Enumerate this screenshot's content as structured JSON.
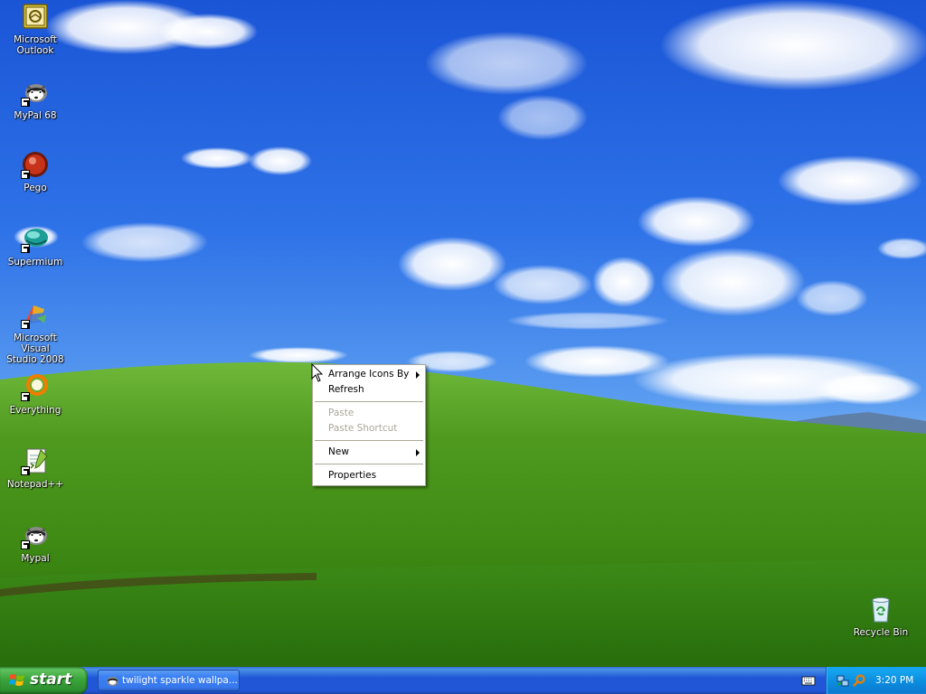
{
  "desktop": {
    "icons": [
      {
        "label_line1": "Microsoft",
        "label_line2": "Outlook",
        "icon": "outlook-icon"
      },
      {
        "label_line1": "MyPal 68",
        "label_line2": "",
        "icon": "mypal-icon"
      },
      {
        "label_line1": "Pego",
        "label_line2": "",
        "icon": "pego-icon"
      },
      {
        "label_line1": "Supermium",
        "label_line2": "",
        "icon": "supermium-icon"
      },
      {
        "label_line1": "Microsoft Visual",
        "label_line2": "Studio 2008",
        "icon": "visual-studio-icon"
      },
      {
        "label_line1": "Everything",
        "label_line2": "",
        "icon": "everything-icon"
      },
      {
        "label_line1": "Notepad++",
        "label_line2": "",
        "icon": "notepad-plus-plus-icon"
      },
      {
        "label_line1": "Mypal",
        "label_line2": "",
        "icon": "mypal-icon"
      },
      {
        "label_line1": "Recycle Bin",
        "label_line2": "",
        "icon": "recycle-bin-icon"
      }
    ]
  },
  "context_menu": {
    "items": [
      {
        "label": "Arrange Icons By",
        "has_submenu": true,
        "enabled": true
      },
      {
        "label": "Refresh",
        "has_submenu": false,
        "enabled": true
      },
      {
        "label": "Paste",
        "has_submenu": false,
        "enabled": false
      },
      {
        "label": "Paste Shortcut",
        "has_submenu": false,
        "enabled": false
      },
      {
        "label": "New",
        "has_submenu": true,
        "enabled": true
      },
      {
        "label": "Properties",
        "has_submenu": false,
        "enabled": true
      }
    ]
  },
  "taskbar": {
    "start_label": "start",
    "task_button_label": "twilight sparkle wallpa...",
    "clock": "3:20 PM"
  },
  "colors": {
    "taskbar_blue": "#2157d7",
    "start_green": "#3ba53b",
    "tray_blue": "#0d8fdf",
    "menu_border": "#aca899"
  }
}
